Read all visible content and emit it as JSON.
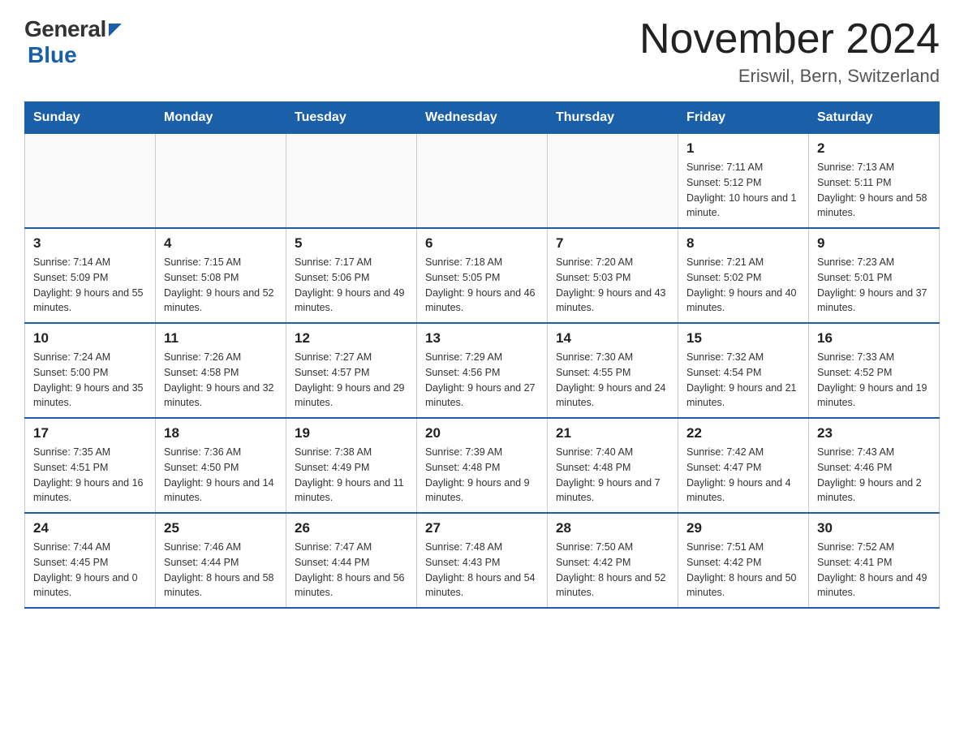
{
  "header": {
    "logo_general": "General",
    "logo_blue": "Blue",
    "month_title": "November 2024",
    "location": "Eriswil, Bern, Switzerland"
  },
  "days_of_week": [
    "Sunday",
    "Monday",
    "Tuesday",
    "Wednesday",
    "Thursday",
    "Friday",
    "Saturday"
  ],
  "weeks": [
    [
      {
        "day": "",
        "info": ""
      },
      {
        "day": "",
        "info": ""
      },
      {
        "day": "",
        "info": ""
      },
      {
        "day": "",
        "info": ""
      },
      {
        "day": "",
        "info": ""
      },
      {
        "day": "1",
        "info": "Sunrise: 7:11 AM\nSunset: 5:12 PM\nDaylight: 10 hours and 1 minute."
      },
      {
        "day": "2",
        "info": "Sunrise: 7:13 AM\nSunset: 5:11 PM\nDaylight: 9 hours and 58 minutes."
      }
    ],
    [
      {
        "day": "3",
        "info": "Sunrise: 7:14 AM\nSunset: 5:09 PM\nDaylight: 9 hours and 55 minutes."
      },
      {
        "day": "4",
        "info": "Sunrise: 7:15 AM\nSunset: 5:08 PM\nDaylight: 9 hours and 52 minutes."
      },
      {
        "day": "5",
        "info": "Sunrise: 7:17 AM\nSunset: 5:06 PM\nDaylight: 9 hours and 49 minutes."
      },
      {
        "day": "6",
        "info": "Sunrise: 7:18 AM\nSunset: 5:05 PM\nDaylight: 9 hours and 46 minutes."
      },
      {
        "day": "7",
        "info": "Sunrise: 7:20 AM\nSunset: 5:03 PM\nDaylight: 9 hours and 43 minutes."
      },
      {
        "day": "8",
        "info": "Sunrise: 7:21 AM\nSunset: 5:02 PM\nDaylight: 9 hours and 40 minutes."
      },
      {
        "day": "9",
        "info": "Sunrise: 7:23 AM\nSunset: 5:01 PM\nDaylight: 9 hours and 37 minutes."
      }
    ],
    [
      {
        "day": "10",
        "info": "Sunrise: 7:24 AM\nSunset: 5:00 PM\nDaylight: 9 hours and 35 minutes."
      },
      {
        "day": "11",
        "info": "Sunrise: 7:26 AM\nSunset: 4:58 PM\nDaylight: 9 hours and 32 minutes."
      },
      {
        "day": "12",
        "info": "Sunrise: 7:27 AM\nSunset: 4:57 PM\nDaylight: 9 hours and 29 minutes."
      },
      {
        "day": "13",
        "info": "Sunrise: 7:29 AM\nSunset: 4:56 PM\nDaylight: 9 hours and 27 minutes."
      },
      {
        "day": "14",
        "info": "Sunrise: 7:30 AM\nSunset: 4:55 PM\nDaylight: 9 hours and 24 minutes."
      },
      {
        "day": "15",
        "info": "Sunrise: 7:32 AM\nSunset: 4:54 PM\nDaylight: 9 hours and 21 minutes."
      },
      {
        "day": "16",
        "info": "Sunrise: 7:33 AM\nSunset: 4:52 PM\nDaylight: 9 hours and 19 minutes."
      }
    ],
    [
      {
        "day": "17",
        "info": "Sunrise: 7:35 AM\nSunset: 4:51 PM\nDaylight: 9 hours and 16 minutes."
      },
      {
        "day": "18",
        "info": "Sunrise: 7:36 AM\nSunset: 4:50 PM\nDaylight: 9 hours and 14 minutes."
      },
      {
        "day": "19",
        "info": "Sunrise: 7:38 AM\nSunset: 4:49 PM\nDaylight: 9 hours and 11 minutes."
      },
      {
        "day": "20",
        "info": "Sunrise: 7:39 AM\nSunset: 4:48 PM\nDaylight: 9 hours and 9 minutes."
      },
      {
        "day": "21",
        "info": "Sunrise: 7:40 AM\nSunset: 4:48 PM\nDaylight: 9 hours and 7 minutes."
      },
      {
        "day": "22",
        "info": "Sunrise: 7:42 AM\nSunset: 4:47 PM\nDaylight: 9 hours and 4 minutes."
      },
      {
        "day": "23",
        "info": "Sunrise: 7:43 AM\nSunset: 4:46 PM\nDaylight: 9 hours and 2 minutes."
      }
    ],
    [
      {
        "day": "24",
        "info": "Sunrise: 7:44 AM\nSunset: 4:45 PM\nDaylight: 9 hours and 0 minutes."
      },
      {
        "day": "25",
        "info": "Sunrise: 7:46 AM\nSunset: 4:44 PM\nDaylight: 8 hours and 58 minutes."
      },
      {
        "day": "26",
        "info": "Sunrise: 7:47 AM\nSunset: 4:44 PM\nDaylight: 8 hours and 56 minutes."
      },
      {
        "day": "27",
        "info": "Sunrise: 7:48 AM\nSunset: 4:43 PM\nDaylight: 8 hours and 54 minutes."
      },
      {
        "day": "28",
        "info": "Sunrise: 7:50 AM\nSunset: 4:42 PM\nDaylight: 8 hours and 52 minutes."
      },
      {
        "day": "29",
        "info": "Sunrise: 7:51 AM\nSunset: 4:42 PM\nDaylight: 8 hours and 50 minutes."
      },
      {
        "day": "30",
        "info": "Sunrise: 7:52 AM\nSunset: 4:41 PM\nDaylight: 8 hours and 49 minutes."
      }
    ]
  ]
}
